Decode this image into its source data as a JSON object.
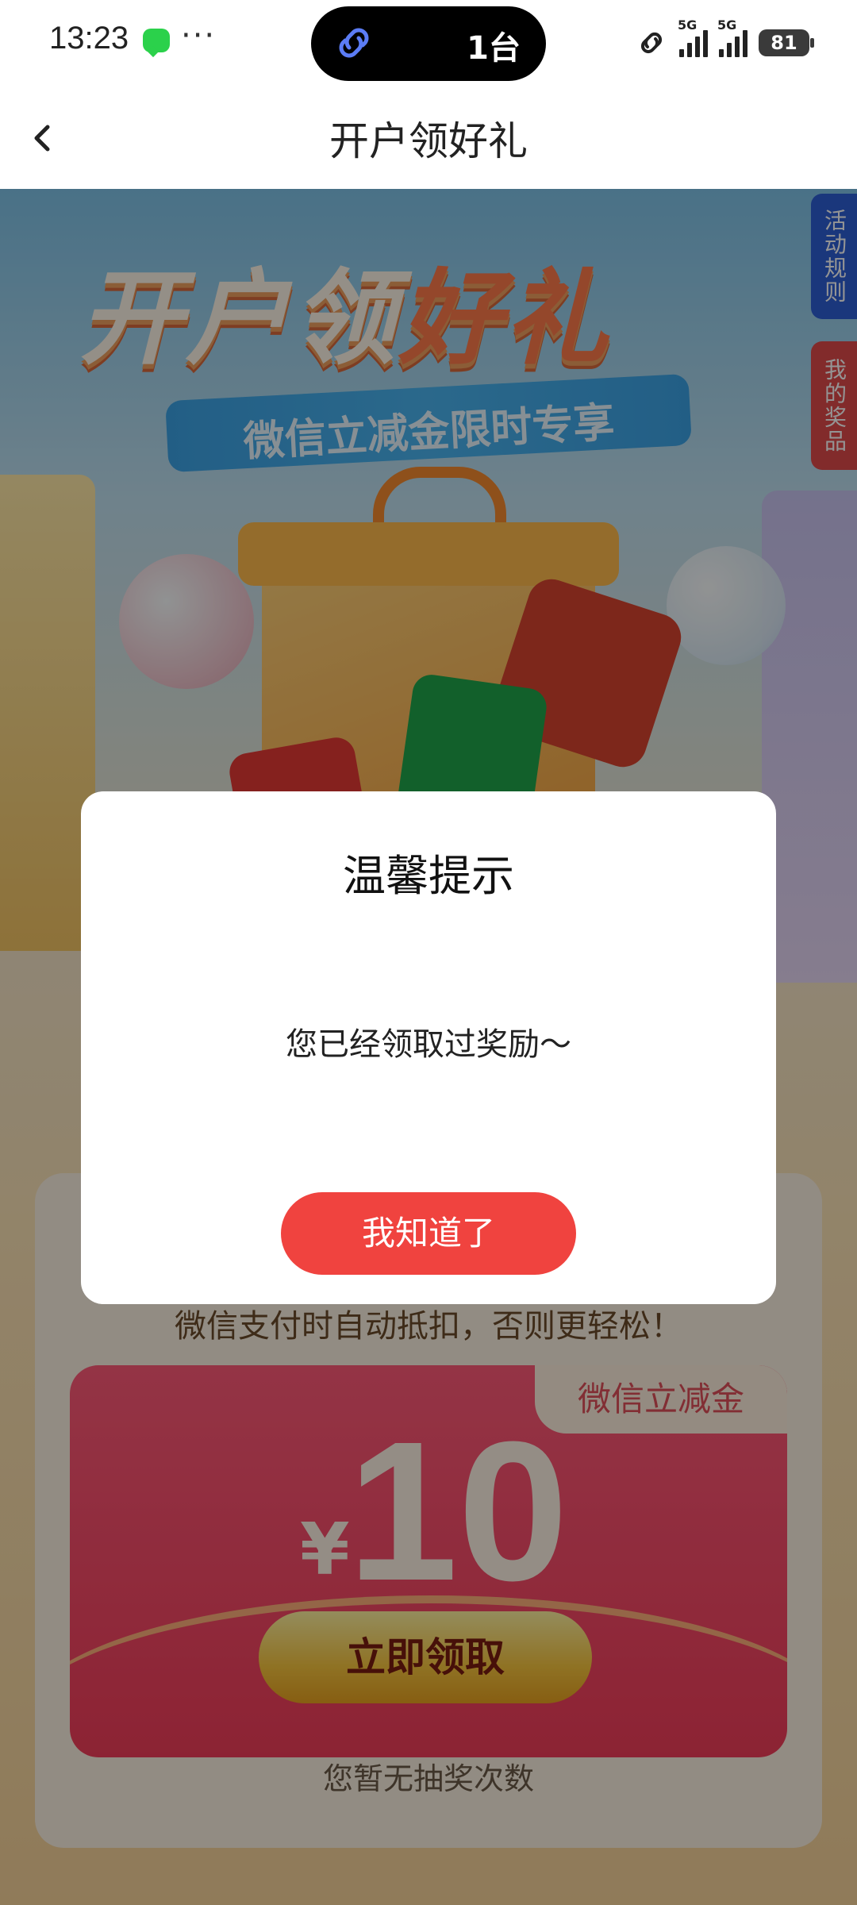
{
  "status_bar": {
    "time": "13:23",
    "more_dots": "···",
    "island_text": "1台",
    "signal1_label": "5G",
    "signal2_label": "5G",
    "battery": "81"
  },
  "nav": {
    "title": "开户领好礼"
  },
  "side_tabs": {
    "rules": "活动规则",
    "prizes": "我的奖品"
  },
  "hero": {
    "title_part1": "开户领",
    "title_part2": "好礼",
    "subtitle": "微信立减金限时专享"
  },
  "coupon": {
    "tag": "微信立减金",
    "currency": "¥",
    "amount": "10",
    "claim_button": "立即领取"
  },
  "panel": {
    "note": "微信支付时自动抵扣，否则更轻松！",
    "no_chance": "您暂无抽奖次数"
  },
  "dialog": {
    "title": "温馨提示",
    "message": "您已经领取过奖励～",
    "confirm_button": "我知道了"
  },
  "colors": {
    "dialog_button": "#f0433f",
    "rules_tab": "#2d5fd6",
    "prizes_tab": "#e14b4b"
  }
}
